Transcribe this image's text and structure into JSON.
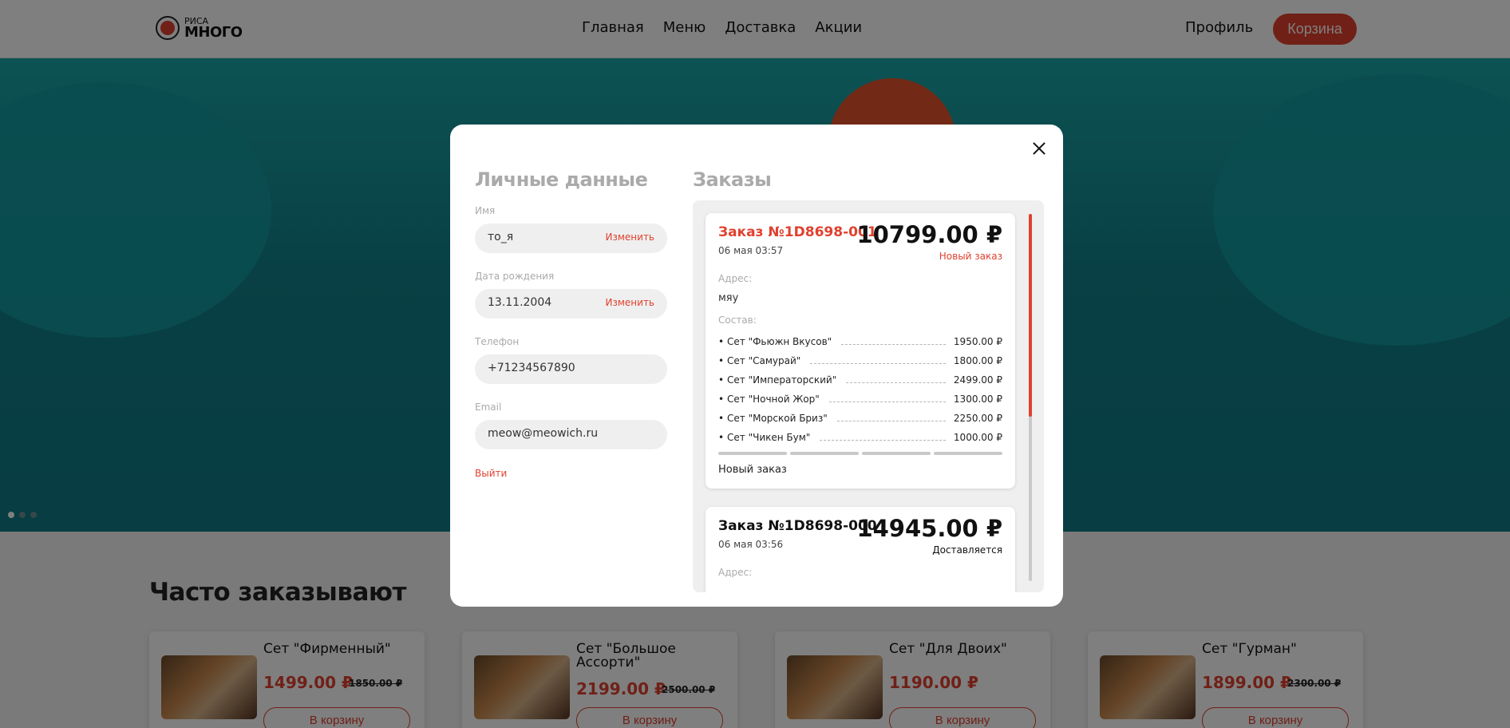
{
  "header": {
    "logo_small": "РИСА",
    "logo_big": "МНОГО",
    "nav": [
      "Главная",
      "Меню",
      "Доставка",
      "Акции"
    ],
    "profile": "Профиль",
    "cart": "Корзина"
  },
  "popular": {
    "title": "Часто заказывают",
    "cards": [
      {
        "title": "Сет \"Фирменный\"",
        "price": "1499.00 ₽",
        "old_price": "1850.00 ₽",
        "button": "В корзину"
      },
      {
        "title": "Сет \"Большое Ассорти\"",
        "price": "2199.00 ₽",
        "old_price": "2500.00 ₽",
        "button": "В корзину"
      },
      {
        "title": "Сет \"Для Двоих\"",
        "price": "1190.00 ₽",
        "old_price": "",
        "button": "В корзину"
      },
      {
        "title": "Сет \"Гурман\"",
        "price": "1899.00 ₽",
        "old_price": "2300.00 ₽",
        "button": "В корзину"
      }
    ]
  },
  "modal": {
    "personal_title": "Личные данные",
    "orders_title": "Заказы",
    "fields": {
      "name": {
        "label": "Имя",
        "value": "то_я",
        "action": "Изменить"
      },
      "birthday": {
        "label": "Дата рождения",
        "value": "13.11.2004",
        "action": "Изменить"
      },
      "phone": {
        "label": "Телефон",
        "value": "+71234567890"
      },
      "email": {
        "label": "Email",
        "value": "meow@meowich.ru"
      }
    },
    "logout": "Выйти",
    "orders": [
      {
        "title": "Заказ №1D8698-001",
        "date": "06 мая 03:57",
        "total": "10799.00 ₽",
        "status": "Новый заказ",
        "address_label": "Адрес:",
        "address": "мяу",
        "items_label": "Состав:",
        "items": [
          {
            "name": "Сет \"Фьюжн Вкусов\"",
            "price": "1950.00 ₽"
          },
          {
            "name": "Сет \"Самурай\"",
            "price": "1800.00 ₽"
          },
          {
            "name": "Сет \"Императорский\"",
            "price": "2499.00 ₽"
          },
          {
            "name": "Сет \"Ночной Жор\"",
            "price": "1300.00 ₽"
          },
          {
            "name": "Сет \"Морской Бриз\"",
            "price": "2250.00 ₽"
          },
          {
            "name": "Сет \"Чикен Бум\"",
            "price": "1000.00 ₽"
          }
        ],
        "progress_steps_total": 4,
        "progress_steps_done": 0,
        "footer_status": "Новый заказ"
      },
      {
        "title": "Заказ №1D8698-000",
        "date": "06 мая 03:56",
        "total": "14945.00 ₽",
        "status": "Доставляется",
        "address_label": "Адрес:"
      }
    ]
  },
  "colors": {
    "accent": "#e0412f",
    "banner": "#11808a",
    "field_bg": "#efefef"
  },
  "banner_slides": {
    "count": 3,
    "active": 1
  }
}
